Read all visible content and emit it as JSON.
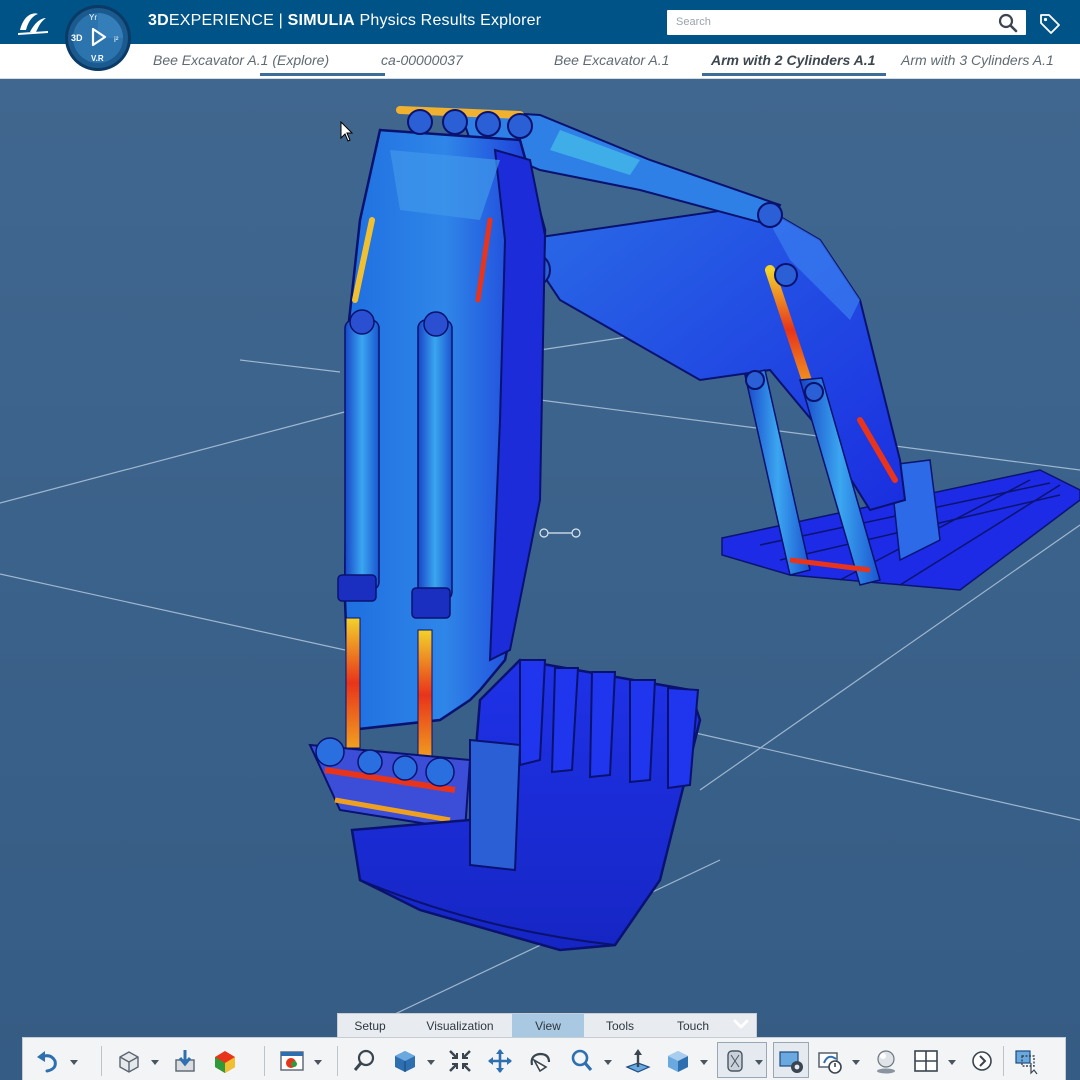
{
  "app": {
    "brand_prefix": "3D",
    "brand_main": "EXPERIENCE",
    "separator": "|",
    "brand_product": "SIMULIA",
    "app_name": "Physics Results Explorer"
  },
  "compass": {
    "label_3d": "3D",
    "label_vr": "V.R"
  },
  "search": {
    "placeholder": "Search"
  },
  "tabs": [
    {
      "label": "Bee Excavator A.1 (Explore)"
    },
    {
      "label": "ca-00000037"
    },
    {
      "label": "Bee Excavator A.1"
    },
    {
      "label": "Arm with 2 Cylinders A.1"
    },
    {
      "label": "Arm with 3 Cylinders A.1"
    }
  ],
  "active_tab": "Arm with 2 Cylinders A.1",
  "command_tabs": [
    {
      "label": "Setup"
    },
    {
      "label": "Visualization"
    },
    {
      "label": "View"
    },
    {
      "label": "Tools"
    },
    {
      "label": "Touch"
    }
  ],
  "active_command_tab": "View",
  "toolbar_icons": [
    "undo-icon",
    "part-design-icon",
    "import-icon",
    "simulation-icon",
    "image-display-icon",
    "zoom-area-icon",
    "view-cube-icon",
    "fit-all-icon",
    "pan-icon",
    "rotate-icon",
    "zoom-icon",
    "normal-view-icon",
    "iso-view-icon",
    "render-style-icon",
    "view-settings-icon",
    "animation-icon",
    "lighting-icon",
    "layout-icon",
    "next-icon",
    "selection-icon"
  ],
  "colors": {
    "topbar": "#005386",
    "viewport_background": "#3b628a",
    "active_command_tab": "#a9c8e2",
    "tab_underline": "#3e6d99",
    "stress_low": "#1b2de0",
    "stress_high": "#e8341a"
  }
}
